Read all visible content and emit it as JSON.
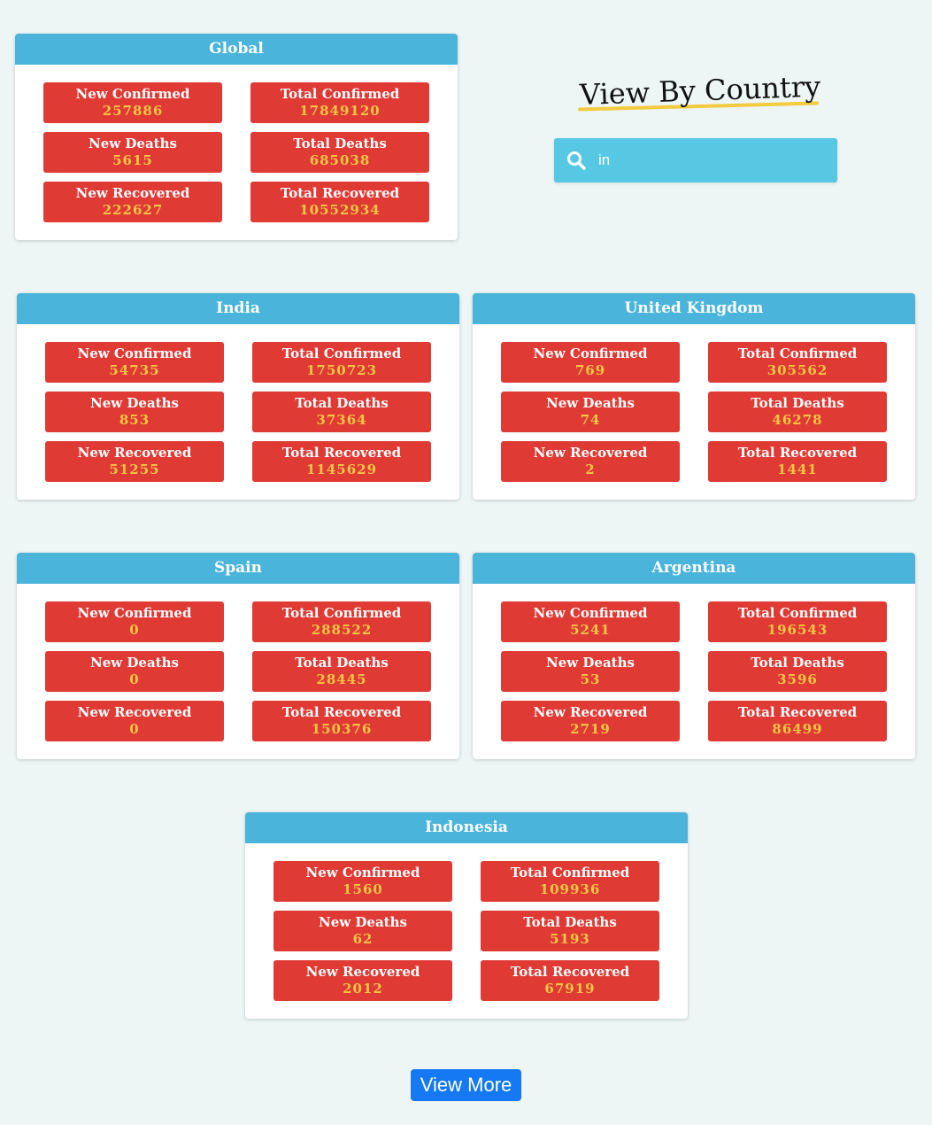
{
  "labels": {
    "new_confirmed": "New Confirmed",
    "total_confirmed": "Total Confirmed",
    "new_deaths": "New Deaths",
    "total_deaths": "Total Deaths",
    "new_recovered": "New Recovered",
    "total_recovered": "Total Recovered"
  },
  "global": {
    "title": "Global",
    "new_confirmed": "257886",
    "total_confirmed": "17849120",
    "new_deaths": "5615",
    "total_deaths": "685038",
    "new_recovered": "222627",
    "total_recovered": "10552934"
  },
  "search": {
    "heading": "View By Country",
    "value": "in",
    "icon": "search-icon"
  },
  "countries": [
    {
      "title": "India",
      "new_confirmed": "54735",
      "total_confirmed": "1750723",
      "new_deaths": "853",
      "total_deaths": "37364",
      "new_recovered": "51255",
      "total_recovered": "1145629"
    },
    {
      "title": "United Kingdom",
      "new_confirmed": "769",
      "total_confirmed": "305562",
      "new_deaths": "74",
      "total_deaths": "46278",
      "new_recovered": "2",
      "total_recovered": "1441"
    },
    {
      "title": "Spain",
      "new_confirmed": "0",
      "total_confirmed": "288522",
      "new_deaths": "0",
      "total_deaths": "28445",
      "new_recovered": "0",
      "total_recovered": "150376"
    },
    {
      "title": "Argentina",
      "new_confirmed": "5241",
      "total_confirmed": "196543",
      "new_deaths": "53",
      "total_deaths": "3596",
      "new_recovered": "2719",
      "total_recovered": "86499"
    },
    {
      "title": "Indonesia",
      "new_confirmed": "1560",
      "total_confirmed": "109936",
      "new_deaths": "62",
      "total_deaths": "5193",
      "new_recovered": "2012",
      "total_recovered": "67919"
    }
  ],
  "view_more_label": "View More",
  "colors": {
    "header": "#4ab4da",
    "stat_bg": "#df3a34",
    "stat_value": "#f6c644",
    "search_bg": "#56c8e4",
    "button": "#1479f2",
    "underline": "#f2cb3e"
  }
}
